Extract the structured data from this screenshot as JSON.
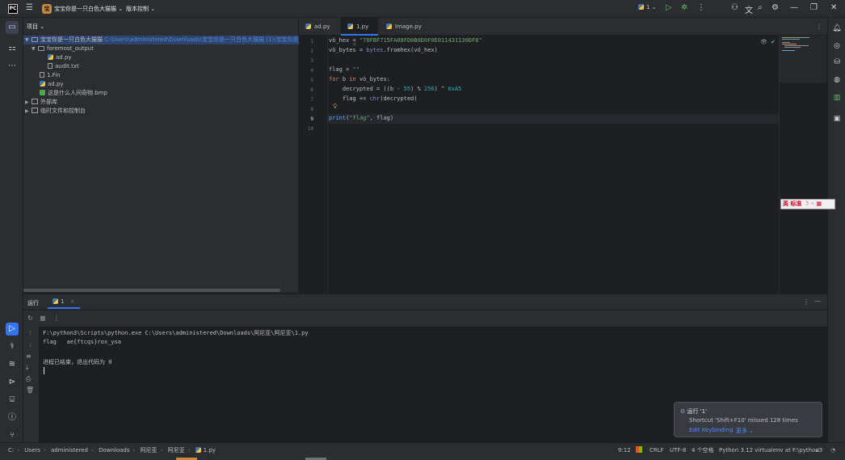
{
  "titlebar": {
    "app_logo": "PC",
    "project_badge": "宝",
    "project_name": "宝宝你是一只白色大猫猫",
    "vcs_menu": "版本控制",
    "run_config": "1",
    "icons": [
      "menu-icon",
      "run-icon",
      "debug-icon",
      "more-icon",
      "account-icon",
      "translate-icon",
      "search-icon",
      "settings-icon",
      "minimize-icon",
      "restore-icon",
      "close-icon"
    ]
  },
  "project_panel": {
    "title": "项目",
    "tree": [
      {
        "label": "宝宝你是一只白色大猫猫",
        "path": "C:\\Users\\administered\\Downloads\\宝宝你是一只白色大猫猫 (1)\\宝宝你是一只白色",
        "depth": 0,
        "type": "folder",
        "expanded": true,
        "selected": true
      },
      {
        "label": "foremost_output",
        "depth": 1,
        "type": "folder",
        "expanded": true
      },
      {
        "label": "ad.py",
        "depth": 2,
        "type": "python"
      },
      {
        "label": "audit.txt",
        "depth": 2,
        "type": "text"
      },
      {
        "label": "1.Fin",
        "depth": 1,
        "type": "file"
      },
      {
        "label": "ad.py",
        "depth": 1,
        "type": "python"
      },
      {
        "label": "这是什么人间奇物.bmp",
        "depth": 1,
        "type": "image"
      },
      {
        "label": "外部库",
        "depth": 0,
        "type": "library",
        "expanded": false
      },
      {
        "label": "临时文件和控制台",
        "depth": 0,
        "type": "scratch",
        "expanded": false
      }
    ]
  },
  "editor": {
    "tabs": [
      {
        "label": "ad.py",
        "active": false
      },
      {
        "label": "1.py",
        "active": true,
        "closable": true
      },
      {
        "label": "Image.py",
        "active": false
      }
    ],
    "line_numbers": [
      "1",
      "2",
      "3",
      "4",
      "5",
      "6",
      "7",
      "8",
      "9",
      "10"
    ],
    "code": {
      "l1_a": "vö_hex = ",
      "l1_b": "\"70FBF715FA08FD0B0D0F0E011431130DF8\"",
      "l2_a": "vö_bytes = ",
      "l2_b": "bytes",
      "l2_c": ".fromhex(vö_hex)",
      "l4_a": "flag = ",
      "l4_b": "\"\"",
      "l5_a": "for",
      "l5_b": " b ",
      "l5_c": "in",
      "l5_d": " vö_bytes:",
      "l6_a": "    decrypted = ((b - ",
      "l6_b": "55",
      "l6_c": ") % ",
      "l6_d": "256",
      "l6_e": ") ^ ",
      "l6_f": "0xA5",
      "l7_a": "    flag += ",
      "l7_b": "chr",
      "l7_c": "(decrypted)",
      "l9_a": "print",
      "l9_b": "(",
      "l9_c": "\"flag\"",
      "l9_d": ", flag)"
    },
    "ime_bar": "英 标准 ☽ ◦ ▦"
  },
  "run_panel": {
    "title": "运行",
    "tab_label": "1",
    "console": [
      "F:\\python3\\Scripts\\python.exe C:\\Users\\administered\\Downloads\\阿尼亚\\阿尼亚\\1.py",
      "flag   ae{ftcqs}rox_ysa",
      "",
      "进程已结束，退出代码为 0"
    ]
  },
  "notification": {
    "title": "运行 '1'",
    "message": "Shortcut 'Shift+F10' missed 128 times",
    "action_keybinding": "Edit Keybinding",
    "action_more": "更多"
  },
  "statusbar": {
    "breadcrumbs": [
      "C:",
      "Users",
      "administered",
      "Downloads",
      "阿尼亚",
      "阿尼亚",
      "1.py"
    ],
    "position": "9:12",
    "line_ending": "CRLF",
    "encoding": "UTF-8",
    "indent": "4 个空格",
    "interpreter": "Python 3.12 virtualenv at F:\\python3"
  }
}
